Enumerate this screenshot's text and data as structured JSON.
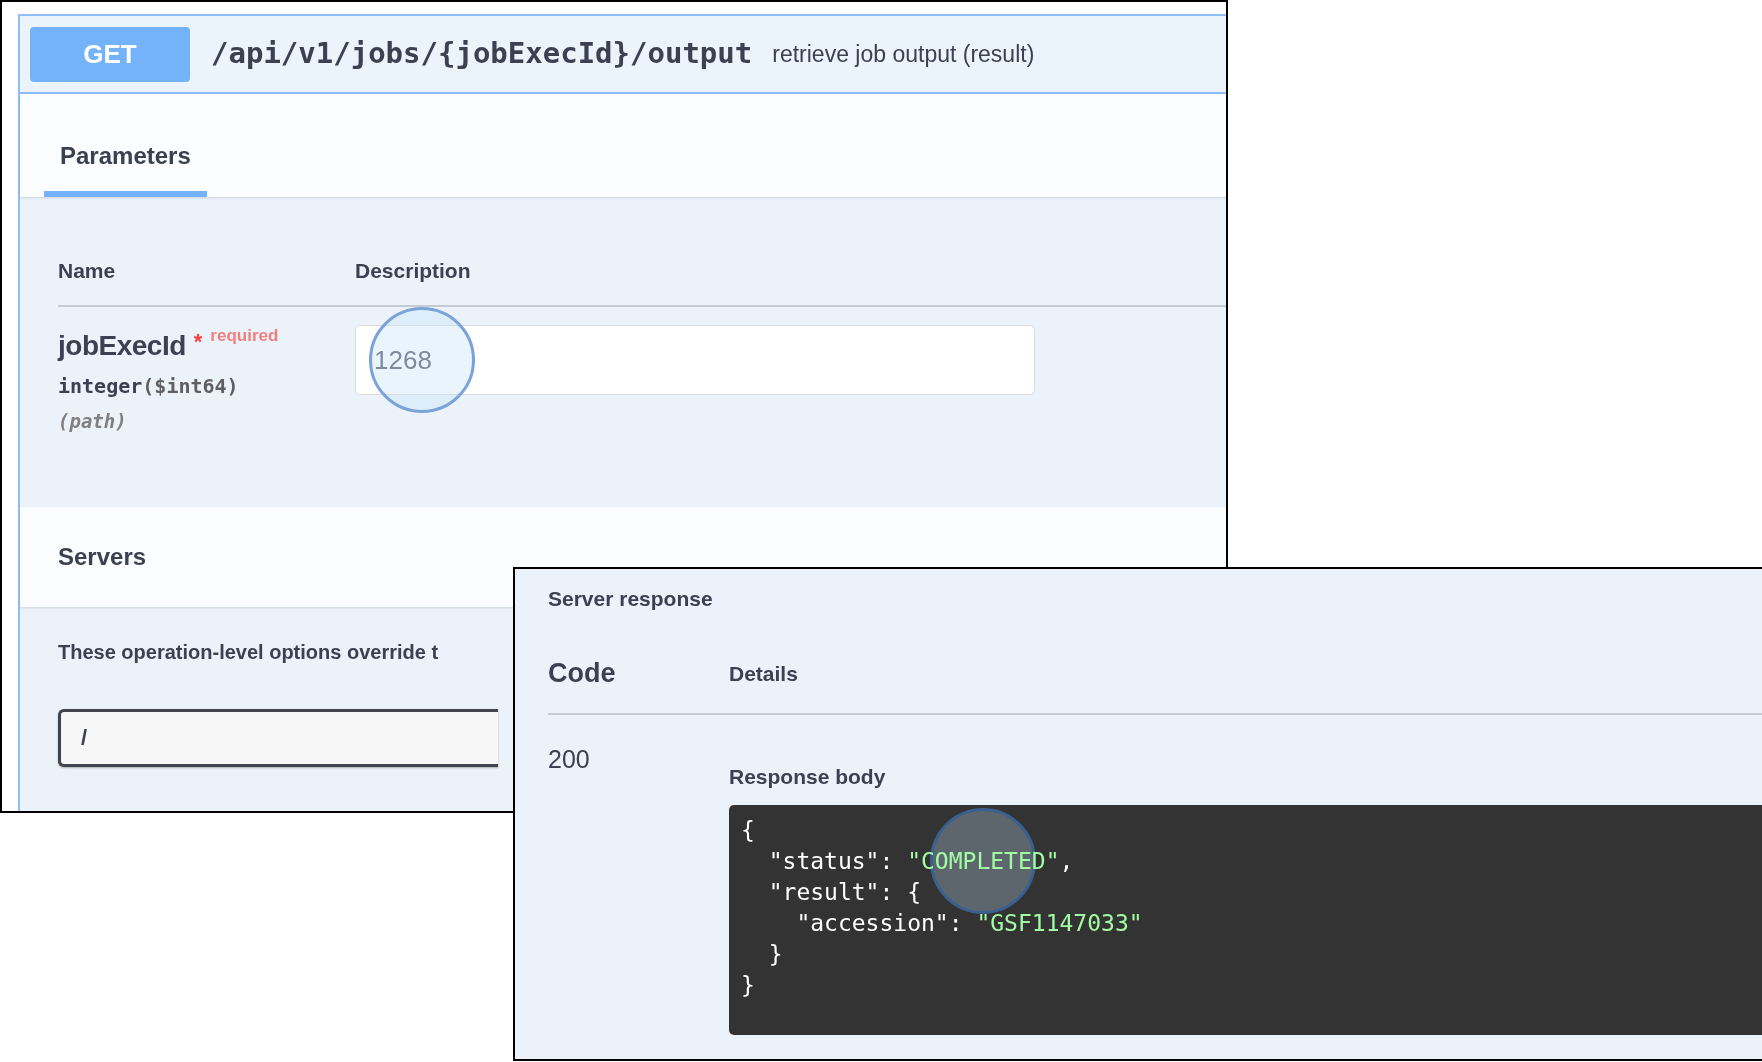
{
  "operation": {
    "method": "GET",
    "path": "/api/v1/jobs/{jobExecId}/output",
    "summary": "retrieve job output (result)"
  },
  "tabs": [
    {
      "label": "Parameters",
      "selected": true
    }
  ],
  "parameters": {
    "columns": [
      "Name",
      "Description"
    ],
    "rows": [
      {
        "name": "jobExecId",
        "required_mark": "*",
        "required_label": "required",
        "type": "integer",
        "format": "($int64)",
        "location": "(path)",
        "value": "1268",
        "tap_marker": true
      }
    ]
  },
  "servers": {
    "title": "Servers",
    "note": "These operation-level options override t",
    "value": "/"
  },
  "response": {
    "title": "Server response",
    "columns": [
      "Code",
      "Details"
    ],
    "code": "200",
    "body_label": "Response body",
    "body_lines": [
      [
        {
          "text": "{",
          "kind": "plain"
        }
      ],
      [
        {
          "text": "  \"status\": ",
          "kind": "plain"
        },
        {
          "text": "\"COMPLETED\"",
          "kind": "string",
          "tap_marker": true
        },
        {
          "text": ",",
          "kind": "plain"
        }
      ],
      [
        {
          "text": "  \"result\": {",
          "kind": "plain"
        }
      ],
      [
        {
          "text": "    \"accession\": ",
          "kind": "plain"
        },
        {
          "text": "\"GSF1147033\"",
          "kind": "string"
        }
      ],
      [
        {
          "text": "  }",
          "kind": "plain"
        }
      ],
      [
        {
          "text": "}",
          "kind": "plain"
        }
      ]
    ]
  }
}
